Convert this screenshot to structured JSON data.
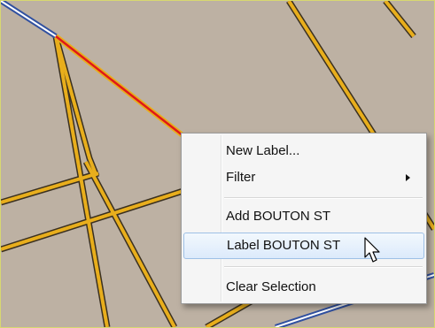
{
  "map": {
    "background_color": "#bdb1a3",
    "street_color": "#e8ae1c",
    "street_outline_color": "#3a3020",
    "selected_street_color": "#e01818",
    "highway_color": "#3050a0",
    "highway_center_color": "#ffffff"
  },
  "context_menu": {
    "items": [
      {
        "label": "New Label..."
      },
      {
        "label": "Filter",
        "has_submenu": true
      },
      {
        "label": "Add BOUTON ST"
      },
      {
        "label": "Label BOUTON ST",
        "highlighted": true
      },
      {
        "label": "Clear Selection"
      }
    ]
  },
  "cursor": {
    "icon": "arrow-pointer-icon"
  }
}
